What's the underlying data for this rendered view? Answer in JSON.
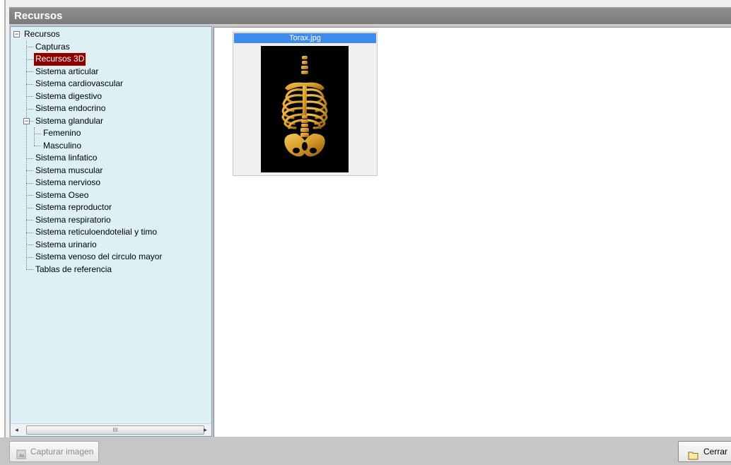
{
  "window": {
    "title": "Recursos"
  },
  "tree": {
    "root": "Recursos",
    "items": [
      {
        "label": "Capturas",
        "level": 1
      },
      {
        "label": "Recursos 3D",
        "level": 1,
        "selected": true
      },
      {
        "label": "Sistema articular",
        "level": 1
      },
      {
        "label": "Sistema cardiovascular",
        "level": 1
      },
      {
        "label": "Sistema digestivo",
        "level": 1
      },
      {
        "label": "Sistema endocrino",
        "level": 1
      },
      {
        "label": "Sistema glandular",
        "level": 1,
        "expanded": true
      },
      {
        "label": "Femenino",
        "level": 2
      },
      {
        "label": "Masculino",
        "level": 2
      },
      {
        "label": "Sistema linfatico",
        "level": 1
      },
      {
        "label": "Sistema muscular",
        "level": 1
      },
      {
        "label": "Sistema nervioso",
        "level": 1
      },
      {
        "label": "Sistema Oseo",
        "level": 1
      },
      {
        "label": "Sistema reproductor",
        "level": 1
      },
      {
        "label": "Sistema respiratorio",
        "level": 1
      },
      {
        "label": "Sistema reticuloendotelial y timo",
        "level": 1
      },
      {
        "label": "Sistema urinario",
        "level": 1
      },
      {
        "label": "Sistema venoso del circulo mayor",
        "level": 1
      },
      {
        "label": "Tablas de referencia",
        "level": 1
      }
    ]
  },
  "scrollbar": {
    "left_arrow": "◂",
    "right_arrow": "▸",
    "thumb_grip": "III"
  },
  "viewer": {
    "items": [
      {
        "caption": "Torax.jpg"
      }
    ]
  },
  "buttons": {
    "capture": "Capturar imagen",
    "close": "Cerrar"
  },
  "colors": {
    "title_bar": "#7f7f7f",
    "tree_bg": "#dcf0f5",
    "selection": "#8b0000",
    "caption_bar": "#3c8cf0",
    "bone": "#d79a28"
  }
}
